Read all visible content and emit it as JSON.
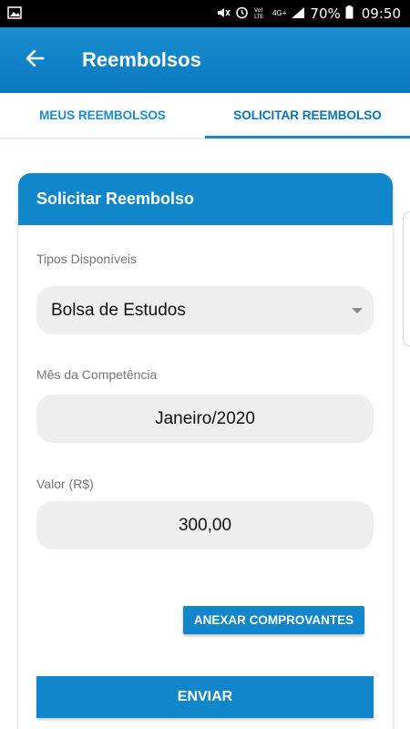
{
  "status_bar": {
    "battery_pct": "70%",
    "time": "09:50",
    "network_label": "4G+",
    "volte_label": "Vo) LTE",
    "icons": [
      "image-icon",
      "mute-icon",
      "alarm-icon",
      "volte-icon",
      "signal-icon",
      "battery-icon"
    ]
  },
  "app_bar": {
    "title": "Reembolsos",
    "back_icon": "arrow-left-icon"
  },
  "tabs": [
    {
      "label": "MEUS REEMBOLSOS",
      "active": false
    },
    {
      "label": "SOLICITAR REEMBOLSO",
      "active": true
    }
  ],
  "card": {
    "title": "Solicitar Reembolso"
  },
  "form": {
    "tipos": {
      "label": "Tipos Disponíveis",
      "value": "Bolsa de Estudos"
    },
    "mes": {
      "label": "Mês da Competência",
      "value": "Janeiro/2020"
    },
    "valor": {
      "label": "Valor (R$)",
      "value": "300,00"
    }
  },
  "buttons": {
    "attach_label": "ANEXAR COMPROVANTES",
    "send_label": "ENVIAR"
  },
  "colors": {
    "primary": "#1286cb",
    "tab_text": "#1b8bcf",
    "field_bg": "#eeeeee"
  }
}
